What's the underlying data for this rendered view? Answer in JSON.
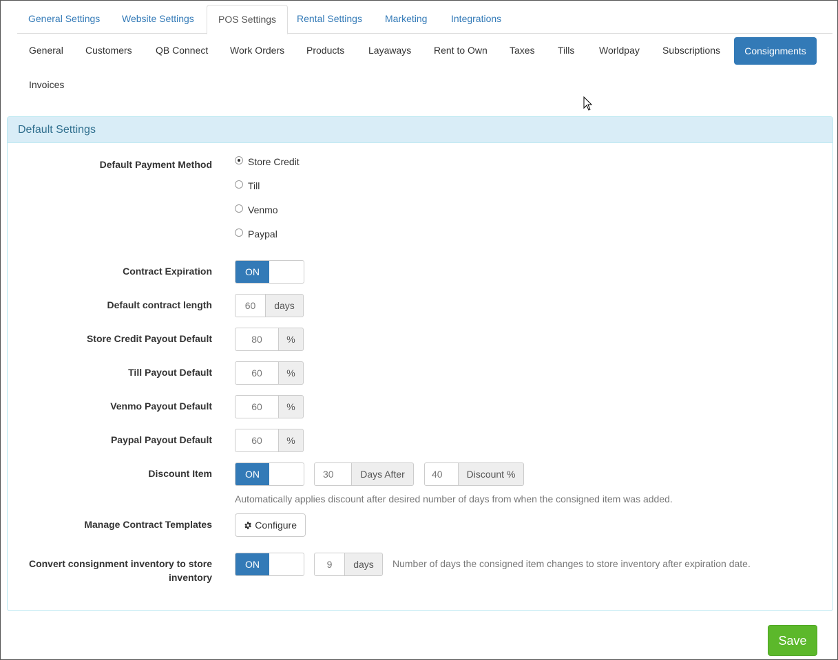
{
  "top_tabs": [
    {
      "label": "General Settings"
    },
    {
      "label": "Website Settings"
    },
    {
      "label": "POS Settings"
    },
    {
      "label": "Rental Settings"
    },
    {
      "label": "Marketing"
    },
    {
      "label": "Integrations"
    }
  ],
  "active_top_tab": "POS Settings",
  "sub_tabs": [
    {
      "label": "General"
    },
    {
      "label": "Customers"
    },
    {
      "label": "QB Connect"
    },
    {
      "label": "Work Orders"
    },
    {
      "label": "Products"
    },
    {
      "label": "Layaways"
    },
    {
      "label": "Rent to Own"
    },
    {
      "label": "Taxes"
    },
    {
      "label": "Tills"
    },
    {
      "label": "Worldpay"
    },
    {
      "label": "Subscriptions"
    },
    {
      "label": "Consignments"
    },
    {
      "label": "Invoices"
    }
  ],
  "active_sub_tab": "Consignments",
  "panel": {
    "title": "Default Settings"
  },
  "form": {
    "payment_method": {
      "label": "Default Payment Method",
      "options": [
        "Store Credit",
        "Till",
        "Venmo",
        "Paypal"
      ],
      "selected": "Store Credit"
    },
    "contract_expiration": {
      "label": "Contract Expiration",
      "toggle": "ON"
    },
    "contract_length": {
      "label": "Default contract length",
      "value": "60",
      "unit": "days"
    },
    "store_credit_payout": {
      "label": "Store Credit Payout Default",
      "value": "80",
      "unit": "%"
    },
    "till_payout": {
      "label": "Till Payout Default",
      "value": "60",
      "unit": "%"
    },
    "venmo_payout": {
      "label": "Venmo Payout Default",
      "value": "60",
      "unit": "%"
    },
    "paypal_payout": {
      "label": "Paypal Payout Default",
      "value": "60",
      "unit": "%"
    },
    "discount_item": {
      "label": "Discount Item",
      "toggle": "ON",
      "days_value": "30",
      "days_unit": "Days After",
      "discount_value": "40",
      "discount_unit": "Discount %",
      "help": "Automatically applies discount after desired number of days from when the consigned item was added."
    },
    "contract_templates": {
      "label": "Manage Contract Templates",
      "button": "Configure"
    },
    "convert_inventory": {
      "label_line1": "Convert consignment inventory to store",
      "label_line2": "inventory",
      "toggle": "ON",
      "days_value": "9",
      "days_unit": "days",
      "help": "Number of days the consigned item changes to store inventory after expiration date."
    }
  },
  "save_button": "Save",
  "colors": {
    "primary": "#337ab7",
    "save": "#5cb82b",
    "panel_heading_bg": "#d9edf7",
    "panel_heading_text": "#31708f"
  }
}
